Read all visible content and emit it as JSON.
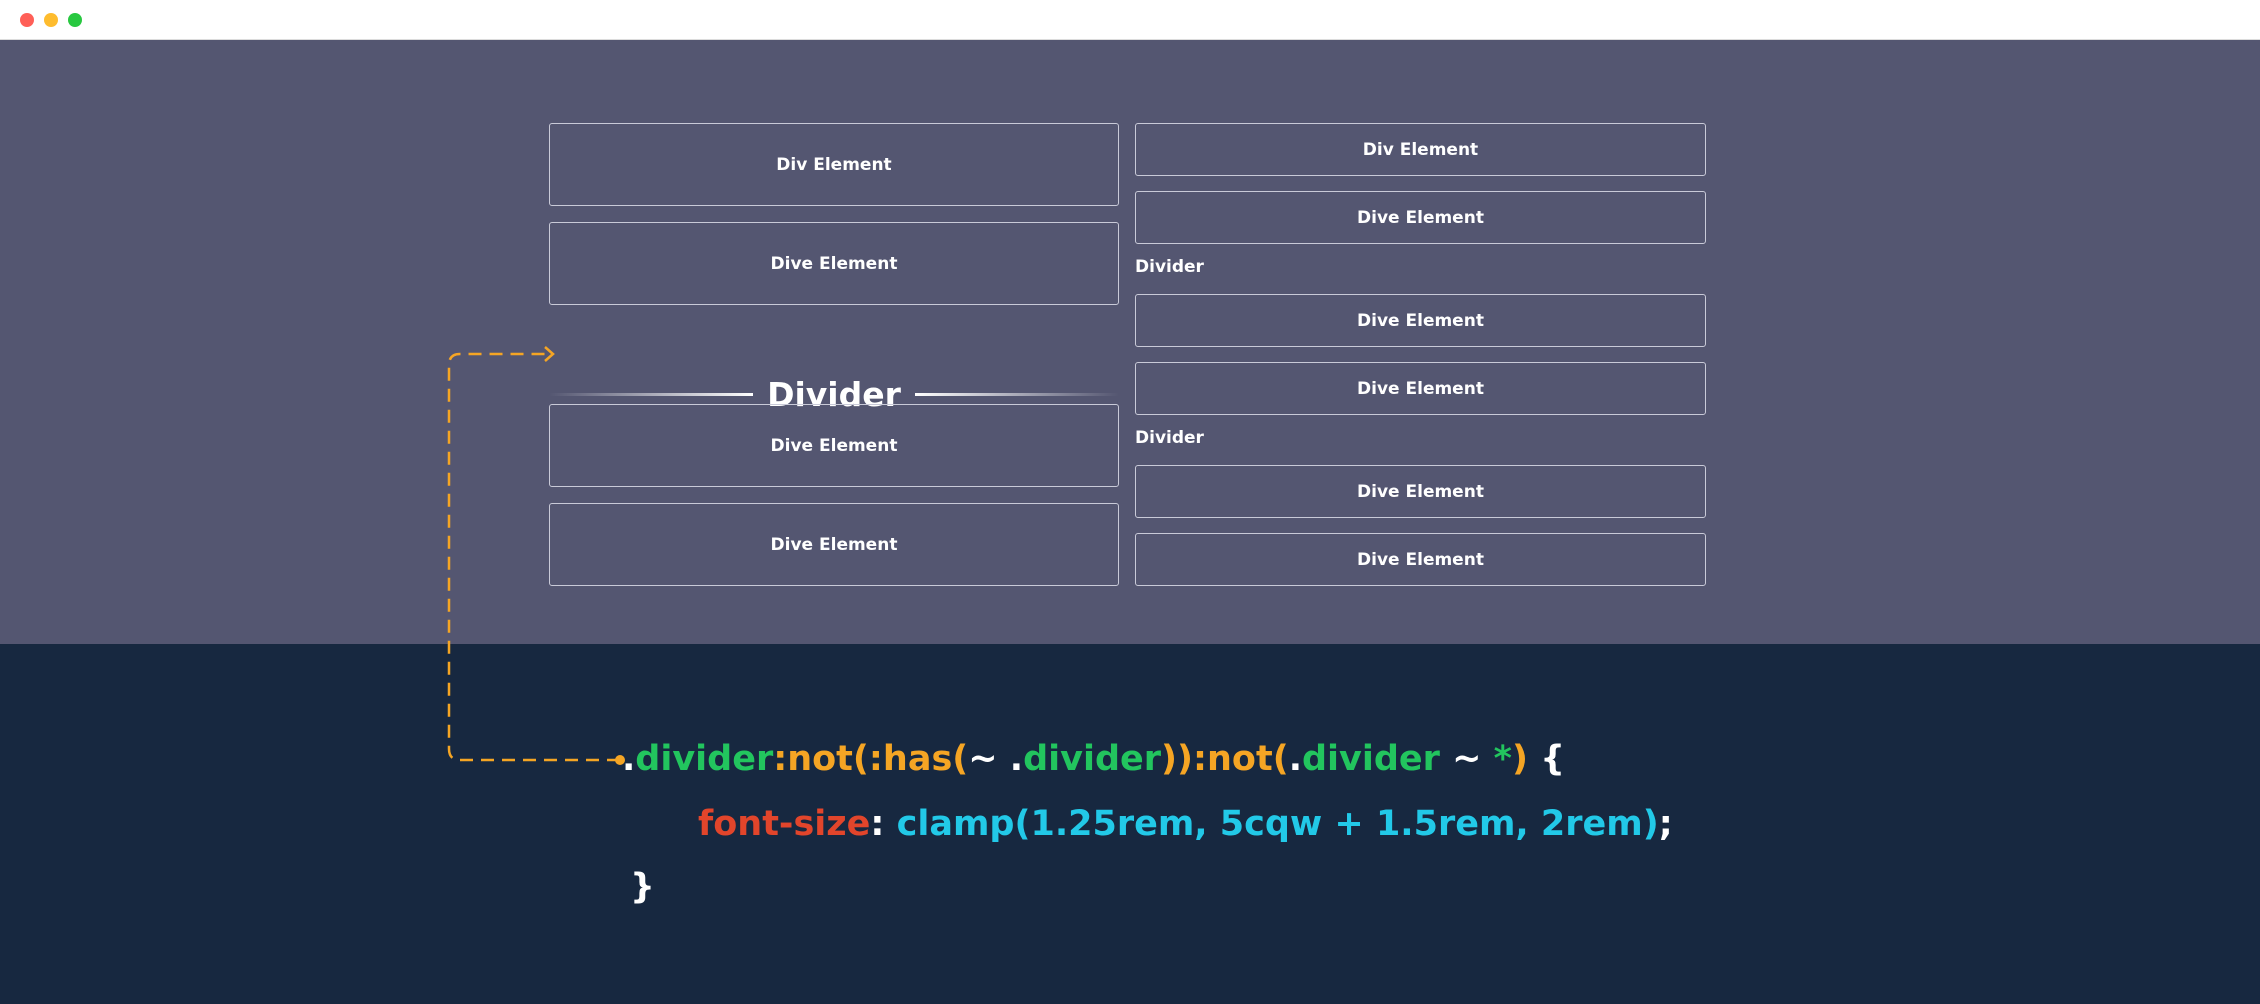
{
  "window": {
    "controls": [
      "close",
      "minimize",
      "maximize"
    ]
  },
  "colors": {
    "demo_background": "#545671",
    "code_background": "#172840",
    "connector": "#f5a524",
    "selector_class": "#22c55e",
    "pseudo": "#f5a524",
    "property": "#e2452b",
    "value": "#22c9e8"
  },
  "demo": {
    "left_column": {
      "boxes_top": [
        "Div Element",
        "Dive Element"
      ],
      "divider": "Divider",
      "boxes_bottom": [
        "Dive Element",
        "Dive Element"
      ]
    },
    "right_column": {
      "group1": [
        "Div Element",
        "Dive Element"
      ],
      "divider1": "Divider",
      "group2": [
        "Dive Element",
        "Dive Element"
      ],
      "divider2": "Divider",
      "group3": [
        "Dive Element",
        "Dive Element"
      ]
    }
  },
  "code": {
    "line1": {
      "dot1": ".",
      "class1": "divider",
      "not1": ":not(",
      "has": ":has(",
      "tilde1": "~ ",
      "dot2": ".",
      "class2": "divider",
      "close1": "))",
      "not2": ":not(",
      "dot3": ".",
      "class3": "divider",
      "tilde2": " ~ ",
      "star": "*",
      "close2": ")",
      "brace_open": " {"
    },
    "line2": {
      "property": "font-size",
      "colon": ": ",
      "value": "clamp(1.25rem, 5cqw + 1.5rem, 2rem)",
      "semicolon": ";"
    },
    "line3": {
      "brace_close": "}"
    }
  }
}
